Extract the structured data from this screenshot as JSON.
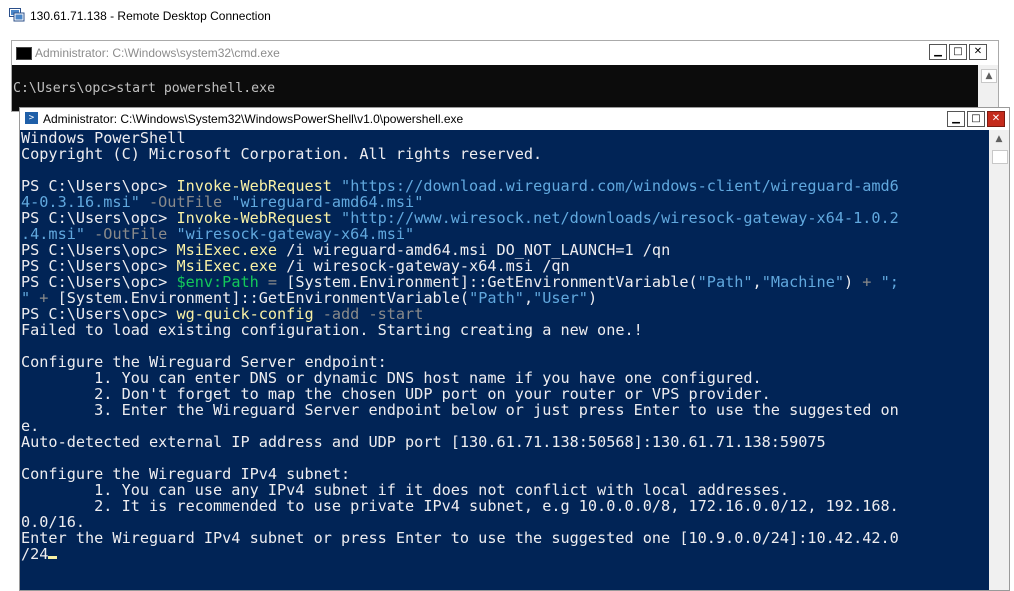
{
  "rdp": {
    "title": "130.61.71.138 - Remote Desktop Connection"
  },
  "cmd": {
    "title": "Administrator: C:\\Windows\\system32\\cmd.exe",
    "line": "C:\\Users\\opc>start powershell.exe"
  },
  "powershell": {
    "title": "Administrator: C:\\Windows\\System32\\WindowsPowerShell\\v1.0\\powershell.exe",
    "lines": [
      [
        {
          "t": "Windows PowerShell",
          "c": "white"
        }
      ],
      [
        {
          "t": "Copyright (C) Microsoft Corporation. All rights reserved.",
          "c": "white"
        }
      ],
      [],
      [
        {
          "t": "PS C:\\Users\\opc> ",
          "c": "white"
        },
        {
          "t": "Invoke-WebRequest",
          "c": "yellow"
        },
        {
          "t": " \"https://download.wireguard.com/windows-client/wireguard-amd6",
          "c": "cyan"
        }
      ],
      [
        {
          "t": "4-0.3.16.msi\"",
          "c": "cyan"
        },
        {
          "t": " -OutFile",
          "c": "gray"
        },
        {
          "t": " \"wireguard-amd64.msi\"",
          "c": "cyan"
        }
      ],
      [
        {
          "t": "PS C:\\Users\\opc> ",
          "c": "white"
        },
        {
          "t": "Invoke-WebRequest",
          "c": "yellow"
        },
        {
          "t": " \"http://www.wiresock.net/downloads/wiresock-gateway-x64-1.0.2",
          "c": "cyan"
        }
      ],
      [
        {
          "t": ".4.msi\"",
          "c": "cyan"
        },
        {
          "t": " -OutFile",
          "c": "gray"
        },
        {
          "t": " \"wiresock-gateway-x64.msi\"",
          "c": "cyan"
        }
      ],
      [
        {
          "t": "PS C:\\Users\\opc> ",
          "c": "white"
        },
        {
          "t": "MsiExec.exe",
          "c": "yellow"
        },
        {
          "t": " /i wireguard-amd64.msi DO_NOT_LAUNCH=1 /qn",
          "c": "white"
        }
      ],
      [
        {
          "t": "PS C:\\Users\\opc> ",
          "c": "white"
        },
        {
          "t": "MsiExec.exe",
          "c": "yellow"
        },
        {
          "t": " /i wiresock-gateway-x64.msi /qn",
          "c": "white"
        }
      ],
      [
        {
          "t": "PS C:\\Users\\opc> ",
          "c": "white"
        },
        {
          "t": "$env:Path",
          "c": "green"
        },
        {
          "t": " = ",
          "c": "gray"
        },
        {
          "t": "[System.Environment]::GetEnvironmentVariable(",
          "c": "white"
        },
        {
          "t": "\"Path\"",
          "c": "cyan"
        },
        {
          "t": ",",
          "c": "white"
        },
        {
          "t": "\"Machine\"",
          "c": "cyan"
        },
        {
          "t": ") ",
          "c": "white"
        },
        {
          "t": "+",
          "c": "gray"
        },
        {
          "t": " \";",
          "c": "cyan"
        }
      ],
      [
        {
          "t": "\"",
          "c": "cyan"
        },
        {
          "t": " + ",
          "c": "gray"
        },
        {
          "t": "[System.Environment]::GetEnvironmentVariable(",
          "c": "white"
        },
        {
          "t": "\"Path\"",
          "c": "cyan"
        },
        {
          "t": ",",
          "c": "white"
        },
        {
          "t": "\"User\"",
          "c": "cyan"
        },
        {
          "t": ")",
          "c": "white"
        }
      ],
      [
        {
          "t": "PS C:\\Users\\opc> ",
          "c": "white"
        },
        {
          "t": "wg-quick-config",
          "c": "yellow"
        },
        {
          "t": " -add -start",
          "c": "gray"
        }
      ],
      [
        {
          "t": "Failed to load existing configuration. Starting creating a new one.!",
          "c": "white"
        }
      ],
      [],
      [
        {
          "t": "Configure the Wireguard Server endpoint:",
          "c": "white"
        }
      ],
      [
        {
          "t": "        1. You can enter DNS or dynamic DNS host name if you have one configured.",
          "c": "white"
        }
      ],
      [
        {
          "t": "        2. Don't forget to map the chosen UDP port on your router or VPS provider.",
          "c": "white"
        }
      ],
      [
        {
          "t": "        3. Enter the Wireguard Server endpoint below or just press Enter to use the suggested on",
          "c": "white"
        }
      ],
      [
        {
          "t": "e.",
          "c": "white"
        }
      ],
      [
        {
          "t": "Auto-detected external IP address and UDP port [130.61.71.138:50568]:130.61.71.138:59075",
          "c": "white"
        }
      ],
      [],
      [
        {
          "t": "Configure the Wireguard IPv4 subnet:",
          "c": "white"
        }
      ],
      [
        {
          "t": "        1. You can use any IPv4 subnet if it does not conflict with local addresses.",
          "c": "white"
        }
      ],
      [
        {
          "t": "        2. It is recommended to use private IPv4 subnet, e.g 10.0.0.0/8, 172.16.0.0/12, 192.168.",
          "c": "white"
        }
      ],
      [
        {
          "t": "0.0/16.",
          "c": "white"
        }
      ],
      [
        {
          "t": "Enter the Wireguard IPv4 subnet or press Enter to use the suggested one [10.9.0.0/24]:10.42.42.0",
          "c": "white"
        }
      ],
      [
        {
          "t": "/24",
          "c": "white"
        },
        {
          "cursor": true
        }
      ]
    ]
  },
  "buttons": {
    "minimize": "▁",
    "maximize": "□",
    "close": "✕"
  },
  "colors": {
    "ps_background": "#012456",
    "cmd_background": "#0c0c0c",
    "close_button": "#c42b1c"
  }
}
